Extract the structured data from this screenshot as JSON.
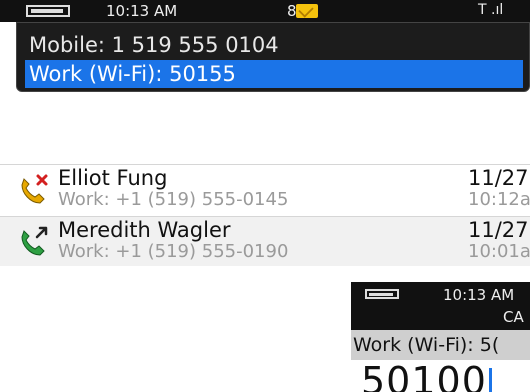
{
  "status_bar": {
    "time": "10:13 AM",
    "notification_count": "8",
    "signal": "T .ıl"
  },
  "number_picker": {
    "options": [
      {
        "label": "Mobile: 1 519 555 0104",
        "selected": false
      },
      {
        "label": "Work (Wi-Fi): 50155",
        "selected": true
      }
    ],
    "highlight_color": "#1b74e8"
  },
  "call_log": [
    {
      "name": "Elliot Fung",
      "detail": "Work: +1 (519) 555-0145",
      "date": "11/27",
      "time": "10:12a",
      "call_type": "missed",
      "icon": "missed-call-icon"
    },
    {
      "name": "Meredith Wagler",
      "detail": "Work: +1 (519) 555-0190",
      "date": "11/27",
      "time": "10:01a",
      "call_type": "outgoing",
      "icon": "outgoing-call-icon"
    }
  ],
  "dialer_inset": {
    "time": "10:13 AM",
    "carrier": "CA",
    "line_label": "Work (Wi-Fi): 5(",
    "number": "50100"
  }
}
